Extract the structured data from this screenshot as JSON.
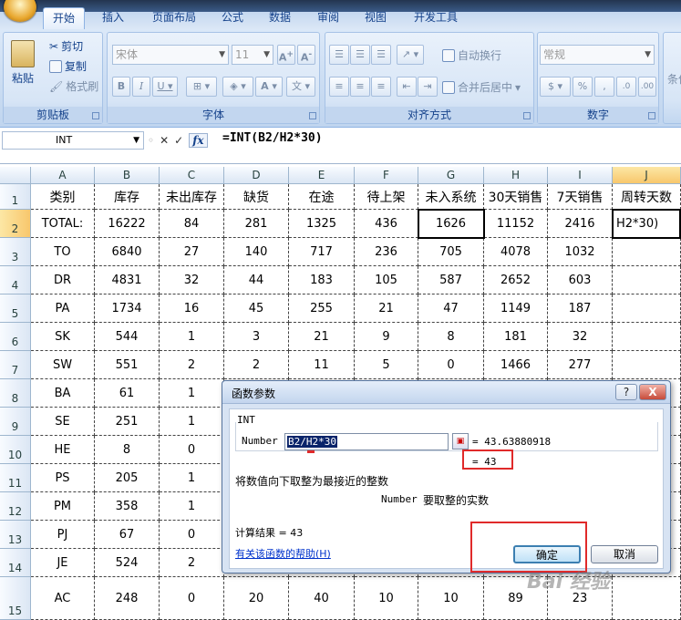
{
  "ribbon": {
    "tabs": [
      "开始",
      "插入",
      "页面布局",
      "公式",
      "数据",
      "审阅",
      "视图",
      "开发工具"
    ],
    "groups": {
      "clipboard": {
        "label": "剪贴板",
        "paste": "粘贴",
        "cut": "剪切",
        "copy": "复制",
        "format_painter": "格式刷"
      },
      "font": {
        "label": "字体",
        "font_name": "宋体",
        "font_size": "11"
      },
      "alignment": {
        "label": "对齐方式",
        "wrap": "自动换行",
        "merge": "合并后居中"
      },
      "number": {
        "label": "数字",
        "format": "常规"
      },
      "cut_off": "条件"
    }
  },
  "formula_bar": {
    "name_box": "INT",
    "formula": "=INT(B2/H2*30)"
  },
  "columns": [
    "A",
    "B",
    "C",
    "D",
    "E",
    "F",
    "G",
    "H",
    "I",
    "J"
  ],
  "rows": [
    {
      "n": "1",
      "cells": [
        "类别",
        "库存",
        "未出库存",
        "缺货",
        "在途",
        "待上架",
        "未入系统",
        "30天销售",
        "7天销售",
        "周转天数"
      ]
    },
    {
      "n": "2",
      "cells": [
        "TOTAL:",
        "16222",
        "84",
        "281",
        "1325",
        "436",
        "1626",
        "11152",
        "2416",
        "H2*30)"
      ]
    },
    {
      "n": "3",
      "cells": [
        "TO",
        "6840",
        "27",
        "140",
        "717",
        "236",
        "705",
        "4078",
        "1032",
        ""
      ]
    },
    {
      "n": "4",
      "cells": [
        "DR",
        "4831",
        "32",
        "44",
        "183",
        "105",
        "587",
        "2652",
        "603",
        ""
      ]
    },
    {
      "n": "5",
      "cells": [
        "PA",
        "1734",
        "16",
        "45",
        "255",
        "21",
        "47",
        "1149",
        "187",
        ""
      ]
    },
    {
      "n": "6",
      "cells": [
        "SK",
        "544",
        "1",
        "3",
        "21",
        "9",
        "8",
        "181",
        "32",
        ""
      ]
    },
    {
      "n": "7",
      "cells": [
        "SW",
        "551",
        "2",
        "2",
        "11",
        "5",
        "0",
        "1466",
        "277",
        ""
      ]
    },
    {
      "n": "8",
      "cells": [
        "BA",
        "61",
        "1",
        "",
        "",
        "",
        "",
        "",
        "",
        ""
      ]
    },
    {
      "n": "9",
      "cells": [
        "SE",
        "251",
        "1",
        "",
        "",
        "",
        "",
        "",
        "",
        ""
      ]
    },
    {
      "n": "10",
      "cells": [
        "HE",
        "8",
        "0",
        "",
        "",
        "",
        "",
        "",
        "",
        ""
      ]
    },
    {
      "n": "11",
      "cells": [
        "PS",
        "205",
        "1",
        "",
        "",
        "",
        "",
        "",
        "",
        ""
      ]
    },
    {
      "n": "12",
      "cells": [
        "PM",
        "358",
        "1",
        "",
        "",
        "",
        "",
        "",
        "",
        ""
      ]
    },
    {
      "n": "13",
      "cells": [
        "PJ",
        "67",
        "0",
        "",
        "",
        "",
        "",
        "",
        "",
        ""
      ]
    },
    {
      "n": "14",
      "cells": [
        "JE",
        "524",
        "2",
        "",
        "",
        "",
        "",
        "",
        "",
        ""
      ]
    },
    {
      "n": "15",
      "cells": [
        "AC",
        "248",
        "0",
        "20",
        "40",
        "10",
        "10",
        "89",
        "23",
        ""
      ]
    }
  ],
  "dialog": {
    "title": "函数参数",
    "help_btn": "?",
    "close_btn": "X",
    "func_name": "INT",
    "arg_label": "Number",
    "arg_value": "B2/H2*30",
    "arg_result": "=  43.63880918",
    "func_result": "=  43",
    "description": "将数值向下取整为最接近的整数",
    "arg_desc_name": "Number",
    "arg_desc": "要取整的实数",
    "calc_result": "计算结果 =  43",
    "help_link": "有关该函数的帮助(H)",
    "ok": "确定",
    "cancel": "取消"
  },
  "watermark": "Bai 经验"
}
